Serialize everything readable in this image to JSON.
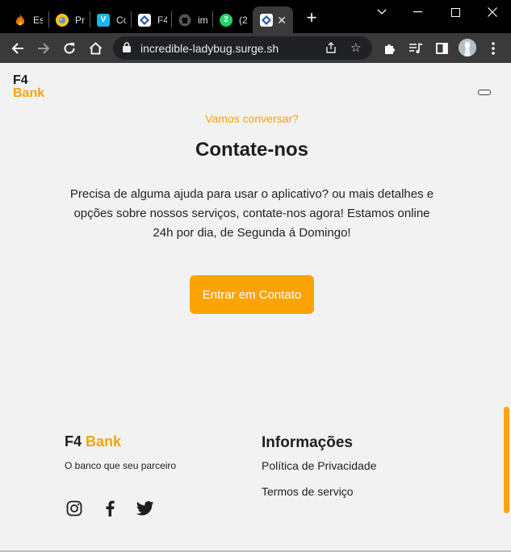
{
  "browser": {
    "tabs": [
      {
        "title": "Es",
        "icon": "flame-icon",
        "color": "#e8710a"
      },
      {
        "title": "Pr",
        "icon": "dog-icon",
        "color": "#f5c518"
      },
      {
        "title": "Co",
        "icon": "vimeo-icon",
        "color": "#1ab7ea"
      },
      {
        "title": "F4",
        "icon": "f4-bank-icon",
        "color": "#2c5aa0"
      },
      {
        "title": "im",
        "icon": "github-icon",
        "color": "#444444"
      },
      {
        "title": "(2",
        "icon": "whatsapp-icon",
        "color": "#25d366"
      },
      {
        "title": "",
        "icon": "f4-bank-icon",
        "color": "#2c5aa0"
      }
    ],
    "url": "incredible-ladybug.surge.sh"
  },
  "header": {
    "logo_line1": "F4",
    "logo_line2": "Bank"
  },
  "contact": {
    "eyebrow": "Vamos conversar?",
    "title": "Contate-nos",
    "description": "Precisa de alguma ajuda para usar o aplicativo? ou mais detalhes e opções sobre nossos serviços, contate-nos agora! Estamos online 24h por dia, de Segunda á Domingo!",
    "button_label": "Entrar em Contato"
  },
  "footer": {
    "logo_part1": "F4",
    "logo_part2": "Bank",
    "tagline": "O banco que seu parceiro",
    "social": [
      "instagram-icon",
      "facebook-icon",
      "twitter-icon"
    ],
    "info_title": "Informações",
    "links": [
      "Política de Privacidade",
      "Termos de serviço"
    ]
  },
  "colors": {
    "accent": "#fba406",
    "background": "#f2f2f2",
    "text": "#1e1e1e"
  }
}
